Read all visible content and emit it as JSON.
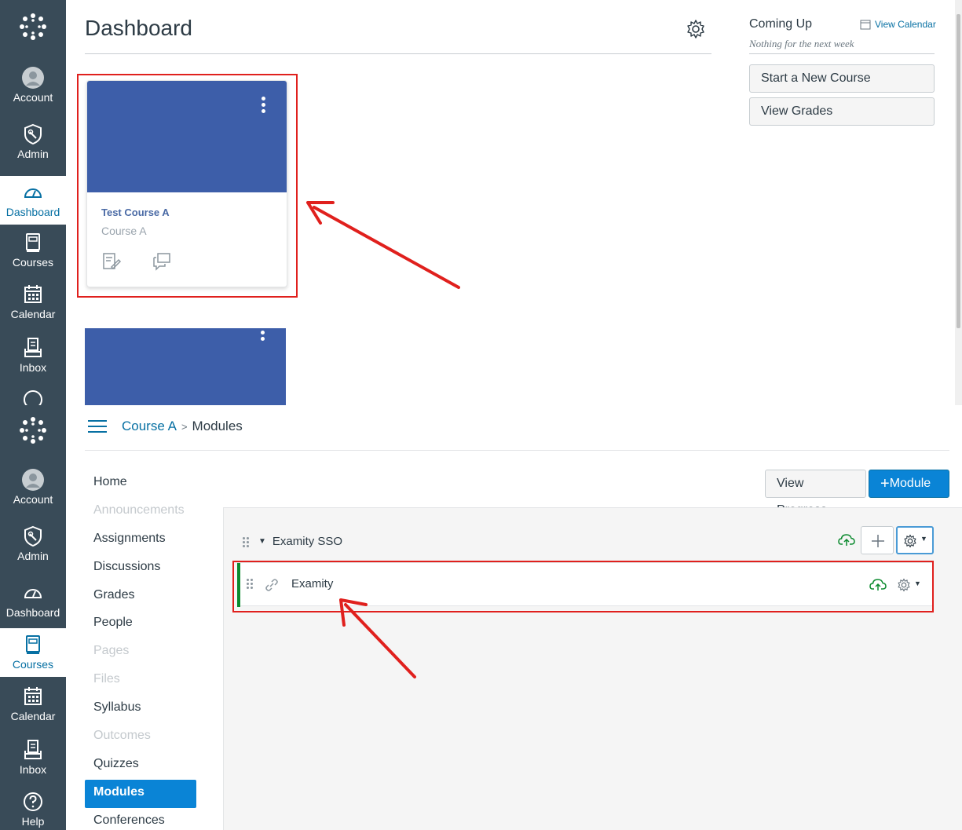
{
  "top": {
    "nav": [
      {
        "label": "Account",
        "icon": "account-icon"
      },
      {
        "label": "Admin",
        "icon": "admin-shield-icon"
      },
      {
        "label": "Dashboard",
        "icon": "dashboard-icon"
      },
      {
        "label": "Courses",
        "icon": "courses-icon"
      },
      {
        "label": "Calendar",
        "icon": "calendar-icon"
      },
      {
        "label": "Inbox",
        "icon": "inbox-icon"
      }
    ],
    "page_title": "Dashboard",
    "card": {
      "title": "Test Course A",
      "code": "Course A",
      "color": "#3d5ea9"
    },
    "sidebar": {
      "coming_up": "Coming Up",
      "view_calendar": "View Calendar",
      "nothing": "Nothing for the next week",
      "buttons": [
        "Start a New Course",
        "View Grades"
      ]
    }
  },
  "bottom": {
    "nav": [
      {
        "label": "Account",
        "icon": "account-icon"
      },
      {
        "label": "Admin",
        "icon": "admin-shield-icon"
      },
      {
        "label": "Dashboard",
        "icon": "dashboard-icon"
      },
      {
        "label": "Courses",
        "icon": "courses-icon"
      },
      {
        "label": "Calendar",
        "icon": "calendar-icon"
      },
      {
        "label": "Inbox",
        "icon": "inbox-icon"
      },
      {
        "label": "Help",
        "icon": "help-icon"
      }
    ],
    "breadcrumb": {
      "course": "Course A",
      "separator": ">",
      "current": "Modules"
    },
    "course_nav": [
      {
        "label": "Home",
        "state": "normal"
      },
      {
        "label": "Announcements",
        "state": "disabled"
      },
      {
        "label": "Assignments",
        "state": "normal"
      },
      {
        "label": "Discussions",
        "state": "normal"
      },
      {
        "label": "Grades",
        "state": "normal"
      },
      {
        "label": "People",
        "state": "normal"
      },
      {
        "label": "Pages",
        "state": "disabled"
      },
      {
        "label": "Files",
        "state": "disabled"
      },
      {
        "label": "Syllabus",
        "state": "normal"
      },
      {
        "label": "Outcomes",
        "state": "disabled"
      },
      {
        "label": "Quizzes",
        "state": "normal"
      },
      {
        "label": "Modules",
        "state": "active"
      },
      {
        "label": "Conferences",
        "state": "normal"
      }
    ],
    "buttons": {
      "view_progress": "View Progress",
      "add_module": "Module"
    },
    "module": {
      "title": "Examity SSO",
      "item": "Examity"
    }
  },
  "colors": {
    "nav_bg": "#394b58",
    "brand_blue": "#0a84d6",
    "link": "#0770a3",
    "publish_green": "#0b8a2e",
    "annotation_red": "#e0201d"
  }
}
